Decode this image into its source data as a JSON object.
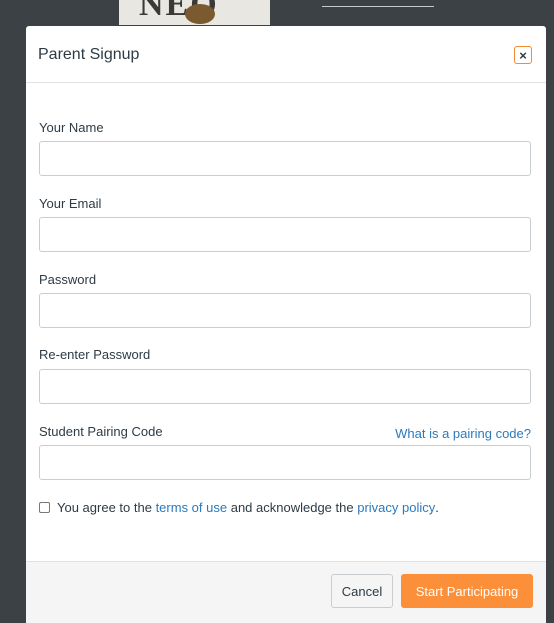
{
  "background": {
    "logo_text": "NEO"
  },
  "modal": {
    "title": "Parent Signup",
    "close_label": "×",
    "fields": [
      {
        "label": "Your Name",
        "value": "",
        "placeholder": ""
      },
      {
        "label": "Your Email",
        "value": "",
        "placeholder": ""
      },
      {
        "label": "Password",
        "value": "",
        "placeholder": ""
      },
      {
        "label": "Re-enter Password",
        "value": "",
        "placeholder": ""
      },
      {
        "label": "Student Pairing Code",
        "value": "",
        "placeholder": ""
      }
    ],
    "pairing_help_link": "What is a pairing code?",
    "agreement": {
      "checked": false,
      "prefix": "You agree to the",
      "terms_link": "terms of use",
      "middle": "and acknowledge the",
      "privacy_link": "privacy policy",
      "suffix": "."
    }
  },
  "footer": {
    "cancel_label": "Cancel",
    "submit_label": "Start Participating"
  },
  "colors": {
    "accent": "#fc8f3a",
    "link": "#2b7abc",
    "text": "#2d3b45",
    "overlay": "#3c4146"
  }
}
